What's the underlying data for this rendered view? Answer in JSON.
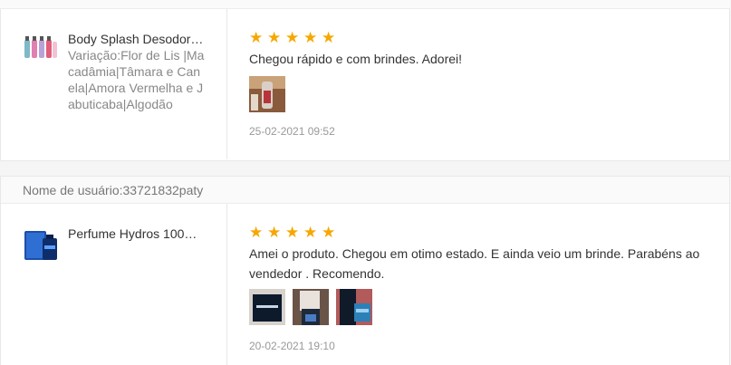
{
  "reviews": [
    {
      "username": "",
      "product": {
        "name": "Body Splash Desodora…",
        "variation": "Variação:Flor de Lis |Macadâmia|Tâmara e Canela|Amora Vermelha e Jabuticaba|Algodão",
        "icon": "body-splash-bottles"
      },
      "rating": 5,
      "stars": [
        "★",
        "★",
        "★",
        "★",
        "★"
      ],
      "comment": "Chegou rápido e com brindes. Adorei!",
      "photo_count": 1,
      "date": "25-02-2021 09:52"
    },
    {
      "username": "Nome de usuário:33721832paty",
      "product": {
        "name": "Perfume Hydros 100m…",
        "variation": "",
        "icon": "perfume-box"
      },
      "rating": 5,
      "stars": [
        "★",
        "★",
        "★",
        "★",
        "★"
      ],
      "comment": "Amei o produto. Chegou em otimo estado. E ainda veio um brinde. Parabéns ao vendedor . Recomendo.",
      "photo_count": 3,
      "date": "20-02-2021 19:10"
    }
  ],
  "colors": {
    "star": "#f6a700",
    "border": "#e8e8e8",
    "header_bg": "#fafafa",
    "muted_text": "#888888"
  }
}
